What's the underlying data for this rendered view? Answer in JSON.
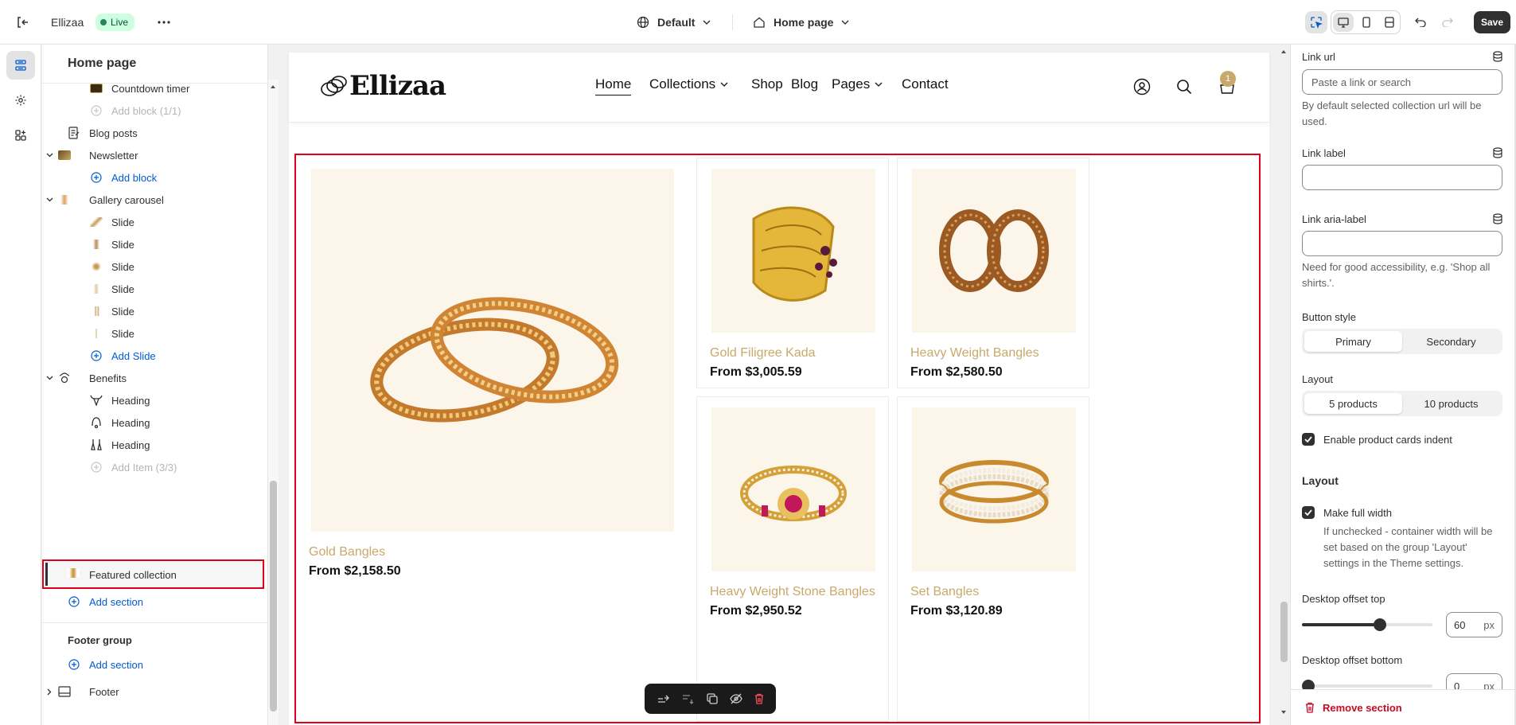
{
  "topbar": {
    "app_name": "Ellizaa",
    "status": "Live",
    "theme": "Default",
    "page": "Home page",
    "save_label": "Save"
  },
  "sidebar": {
    "title": "Home page",
    "items": [
      {
        "label": "Countdown timer",
        "icon": "countdown-thumb-icon",
        "level": 2
      },
      {
        "label": "Add block (1/1)",
        "icon": "add-circle-icon",
        "level": 2,
        "state": "muted"
      },
      {
        "label": "Blog posts",
        "icon": "blog-icon",
        "level": 1
      },
      {
        "label": "Newsletter",
        "icon": "newsletter-thumb-icon",
        "level": 1,
        "expanded": true
      },
      {
        "label": "Add block",
        "icon": "add-circle-icon",
        "level": 2,
        "state": "link"
      },
      {
        "label": "Gallery carousel",
        "icon": "gallery-thumb-icon",
        "level": 1,
        "expanded": true
      },
      {
        "label": "Slide",
        "icon": "slide-thumb-icon",
        "level": 2
      },
      {
        "label": "Slide",
        "icon": "slide-thumb-icon",
        "level": 2
      },
      {
        "label": "Slide",
        "icon": "slide-thumb-icon",
        "level": 2
      },
      {
        "label": "Slide",
        "icon": "slide-thumb-icon",
        "level": 2
      },
      {
        "label": "Slide",
        "icon": "slide-thumb-icon",
        "level": 2
      },
      {
        "label": "Slide",
        "icon": "slide-thumb-icon",
        "level": 2
      },
      {
        "label": "Add Slide",
        "icon": "add-circle-icon",
        "level": 2,
        "state": "link"
      },
      {
        "label": "Benefits",
        "icon": "benefits-icon",
        "level": 1,
        "expanded": true
      },
      {
        "label": "Heading",
        "icon": "bull-icon",
        "level": 2
      },
      {
        "label": "Heading",
        "icon": "necklace-icon",
        "level": 2
      },
      {
        "label": "Heading",
        "icon": "earrings-icon",
        "level": 2
      },
      {
        "label": "Add Item (3/3)",
        "icon": "add-circle-icon",
        "level": 2,
        "state": "muted"
      }
    ],
    "selected": "Featured collection",
    "add_section": "Add section",
    "footer_group": "Footer group",
    "footer_add_section": "Add section",
    "footer": "Footer"
  },
  "store": {
    "logo": "Ellizaa",
    "nav": [
      "Home",
      "Collections",
      "Shop",
      "Blog",
      "Pages",
      "Contact"
    ],
    "cart_count": "1",
    "products": [
      {
        "title": "Gold Bangles",
        "price": "From $2,158.50"
      },
      {
        "title": "Gold Filigree Kada",
        "price": "From $3,005.59"
      },
      {
        "title": "Heavy Weight Bangles",
        "price": "From $2,580.50"
      },
      {
        "title": "Heavy Weight Stone Bangles",
        "price": "From $2,950.52"
      },
      {
        "title": "Set Bangles",
        "price": "From $3,120.89"
      }
    ]
  },
  "settings": {
    "link_url_label": "Link url",
    "link_url_placeholder": "Paste a link or search",
    "link_url_help": "By default selected collection url will be used.",
    "link_label_label": "Link label",
    "link_aria_label": "Link aria-label",
    "link_aria_help": "Need for good accessibility, e.g. 'Shop all shirts.'.",
    "button_style_label": "Button style",
    "button_style_options": [
      "Primary",
      "Secondary"
    ],
    "button_style_selected": "Primary",
    "layout_label": "Layout",
    "layout_options": [
      "5 products",
      "10 products"
    ],
    "layout_selected": "5 products",
    "indent_label": "Enable product cards indent",
    "indent_checked": true,
    "layout_heading": "Layout",
    "full_width_label": "Make full width",
    "full_width_checked": true,
    "full_width_help": "If unchecked - container width will be set based on the group 'Layout' settings in the Theme settings.",
    "offset_top_label": "Desktop offset top",
    "offset_top_value": "60",
    "offset_unit": "px",
    "offset_bottom_label": "Desktop offset bottom",
    "offset_bottom_value": "0",
    "remove_section": "Remove section"
  },
  "colors": {
    "accent": "#c8a96b",
    "selection_border": "#e0001a",
    "live_badge_bg": "#cdfee1",
    "link_blue": "#005bd3",
    "danger": "#c70a24"
  }
}
